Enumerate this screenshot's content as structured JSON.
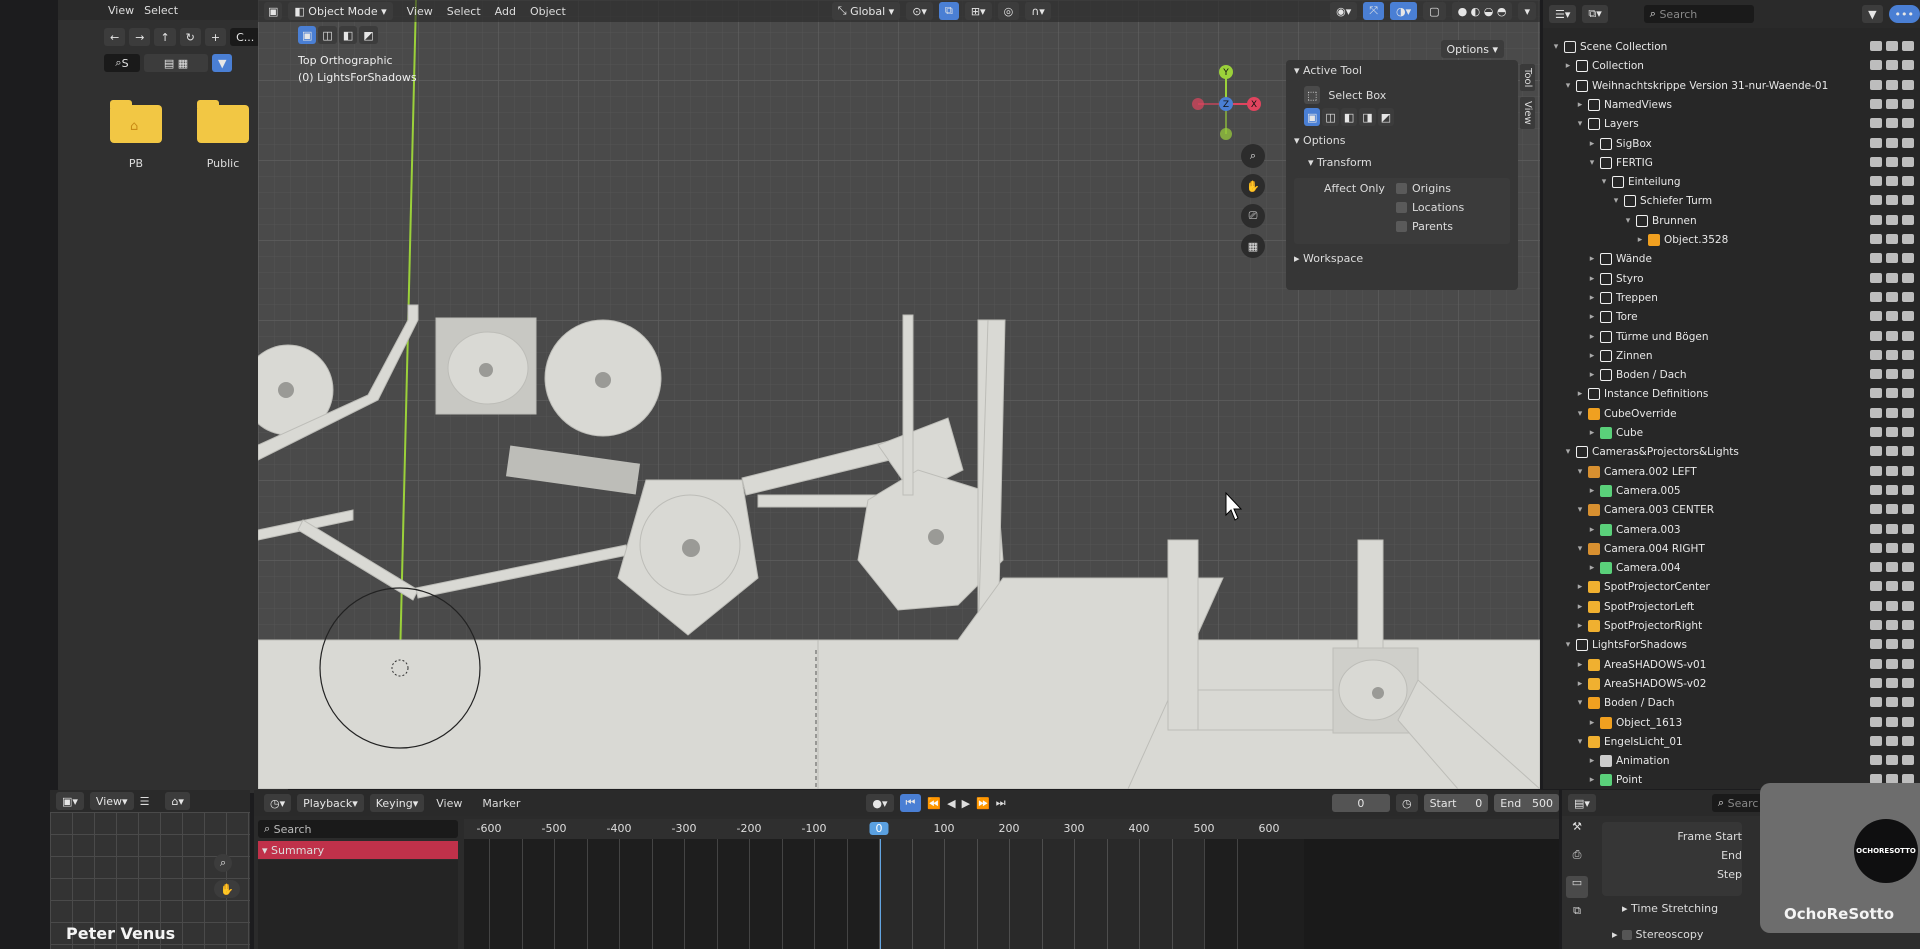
{
  "file_browser": {
    "menu": [
      "View",
      "Select"
    ],
    "path_label": "C...",
    "search_placeholder": "S",
    "folders": [
      {
        "name": "PB",
        "icon": "home-folder-icon"
      },
      {
        "name": "Public",
        "icon": "folder-icon"
      }
    ]
  },
  "viewport": {
    "mode": "Object Mode",
    "menu": [
      "View",
      "Select",
      "Add",
      "Object"
    ],
    "orientation": "Global",
    "view_label": "Top Orthographic",
    "collection_label": "(0) LightsForShadows",
    "options_label": "Options",
    "side_tabs": [
      "Tool",
      "View"
    ],
    "tool_panel": {
      "active_tool_header": "Active Tool",
      "active_tool": "Select Box",
      "options_header": "Options",
      "transform_header": "Transform",
      "affect_only_label": "Affect Only",
      "checkboxes": [
        {
          "label": "Origins",
          "checked": false
        },
        {
          "label": "Locations",
          "checked": false
        },
        {
          "label": "Parents",
          "checked": false
        }
      ],
      "workspace_header": "Workspace"
    },
    "gizmo": {
      "y": "Y",
      "x": "X",
      "z": "Z"
    }
  },
  "outliner": {
    "search_placeholder": "Search",
    "items": [
      {
        "depth": 0,
        "label": "Scene Collection",
        "type": "scene",
        "open": true
      },
      {
        "depth": 1,
        "label": "Collection",
        "type": "collection",
        "open": false
      },
      {
        "depth": 1,
        "label": "Weihnachtskrippe Version 31-nur-Waende-01",
        "type": "collection",
        "open": true
      },
      {
        "depth": 2,
        "label": "NamedViews",
        "type": "collection",
        "open": false
      },
      {
        "depth": 2,
        "label": "Layers",
        "type": "collection",
        "open": true
      },
      {
        "depth": 3,
        "label": "SigBox",
        "type": "collection",
        "open": false
      },
      {
        "depth": 3,
        "label": "FERTIG",
        "type": "collection",
        "open": true
      },
      {
        "depth": 4,
        "label": "Einteilung",
        "type": "collection",
        "open": true
      },
      {
        "depth": 5,
        "label": "Schiefer Turm",
        "type": "collection",
        "open": true
      },
      {
        "depth": 6,
        "label": "Brunnen",
        "type": "collection",
        "open": true
      },
      {
        "depth": 7,
        "label": "Object.3528",
        "type": "mesh",
        "open": false
      },
      {
        "depth": 3,
        "label": "Wände",
        "type": "collection",
        "open": false
      },
      {
        "depth": 3,
        "label": "Styro",
        "type": "collection",
        "open": false
      },
      {
        "depth": 3,
        "label": "Treppen",
        "type": "collection",
        "open": false
      },
      {
        "depth": 3,
        "label": "Tore",
        "type": "collection",
        "open": false
      },
      {
        "depth": 3,
        "label": "Türme und Bögen",
        "type": "collection",
        "open": false
      },
      {
        "depth": 3,
        "label": "Zinnen",
        "type": "collection",
        "open": false
      },
      {
        "depth": 3,
        "label": "Boden / Dach",
        "type": "collection",
        "open": false
      },
      {
        "depth": 2,
        "label": "Instance Definitions",
        "type": "collection",
        "open": false
      },
      {
        "depth": 2,
        "label": "CubeOverride",
        "type": "mesh",
        "open": true
      },
      {
        "depth": 3,
        "label": "Cube",
        "type": "meshdata",
        "open": false
      },
      {
        "depth": 1,
        "label": "Cameras&Projectors&Lights",
        "type": "collection",
        "open": true
      },
      {
        "depth": 2,
        "label": "Camera.002 LEFT",
        "type": "camera",
        "open": true
      },
      {
        "depth": 3,
        "label": "Camera.005",
        "type": "cameradata",
        "open": false
      },
      {
        "depth": 2,
        "label": "Camera.003 CENTER",
        "type": "camera",
        "open": true
      },
      {
        "depth": 3,
        "label": "Camera.003",
        "type": "cameradata",
        "open": false
      },
      {
        "depth": 2,
        "label": "Camera.004 RIGHT",
        "type": "camera",
        "open": true
      },
      {
        "depth": 3,
        "label": "Camera.004",
        "type": "cameradata",
        "open": false
      },
      {
        "depth": 2,
        "label": "SpotProjectorCenter",
        "type": "light",
        "open": false
      },
      {
        "depth": 2,
        "label": "SpotProjectorLeft",
        "type": "light",
        "open": false
      },
      {
        "depth": 2,
        "label": "SpotProjectorRight",
        "type": "light",
        "open": false
      },
      {
        "depth": 1,
        "label": "LightsForShadows",
        "type": "collection",
        "open": true
      },
      {
        "depth": 2,
        "label": "AreaSHADOWS-v01",
        "type": "light",
        "open": false
      },
      {
        "depth": 2,
        "label": "AreaSHADOWS-v02",
        "type": "light",
        "open": false
      },
      {
        "depth": 2,
        "label": "Boden / Dach",
        "type": "empty",
        "open": true
      },
      {
        "depth": 3,
        "label": "Object_1613",
        "type": "mesh",
        "open": false
      },
      {
        "depth": 2,
        "label": "EngelsLicht_01",
        "type": "light",
        "open": true
      },
      {
        "depth": 3,
        "label": "Animation",
        "type": "anim",
        "open": false
      },
      {
        "depth": 3,
        "label": "Point",
        "type": "lightdata",
        "open": false
      }
    ]
  },
  "timeline": {
    "menu": [
      "Playback",
      "Keying",
      "View",
      "Marker"
    ],
    "current_frame": "0",
    "start_label": "Start",
    "start": "0",
    "end_label": "End",
    "end": "500",
    "search_placeholder": "Search",
    "summary_label": "Summary",
    "ticks": [
      "-600",
      "-500",
      "-400",
      "-300",
      "-200",
      "-100",
      "0",
      "100",
      "200",
      "300",
      "400",
      "500",
      "600"
    ]
  },
  "left_bottom": {
    "view_label": "View",
    "name": "Peter Venus"
  },
  "properties": {
    "search_placeholder": "Searc",
    "fields": [
      "Frame Start",
      "End",
      "Step"
    ],
    "sections": [
      "Time Stretching",
      "Stereoscopy"
    ]
  },
  "webcam": {
    "label": "OchoReSotto",
    "logo_text": "OCHORESOTTO"
  },
  "colors": {
    "accent": "#4a7fd4",
    "playhead": "#5aa0e0",
    "summary": "#c0314a",
    "axis_y": "#9bd13a"
  }
}
